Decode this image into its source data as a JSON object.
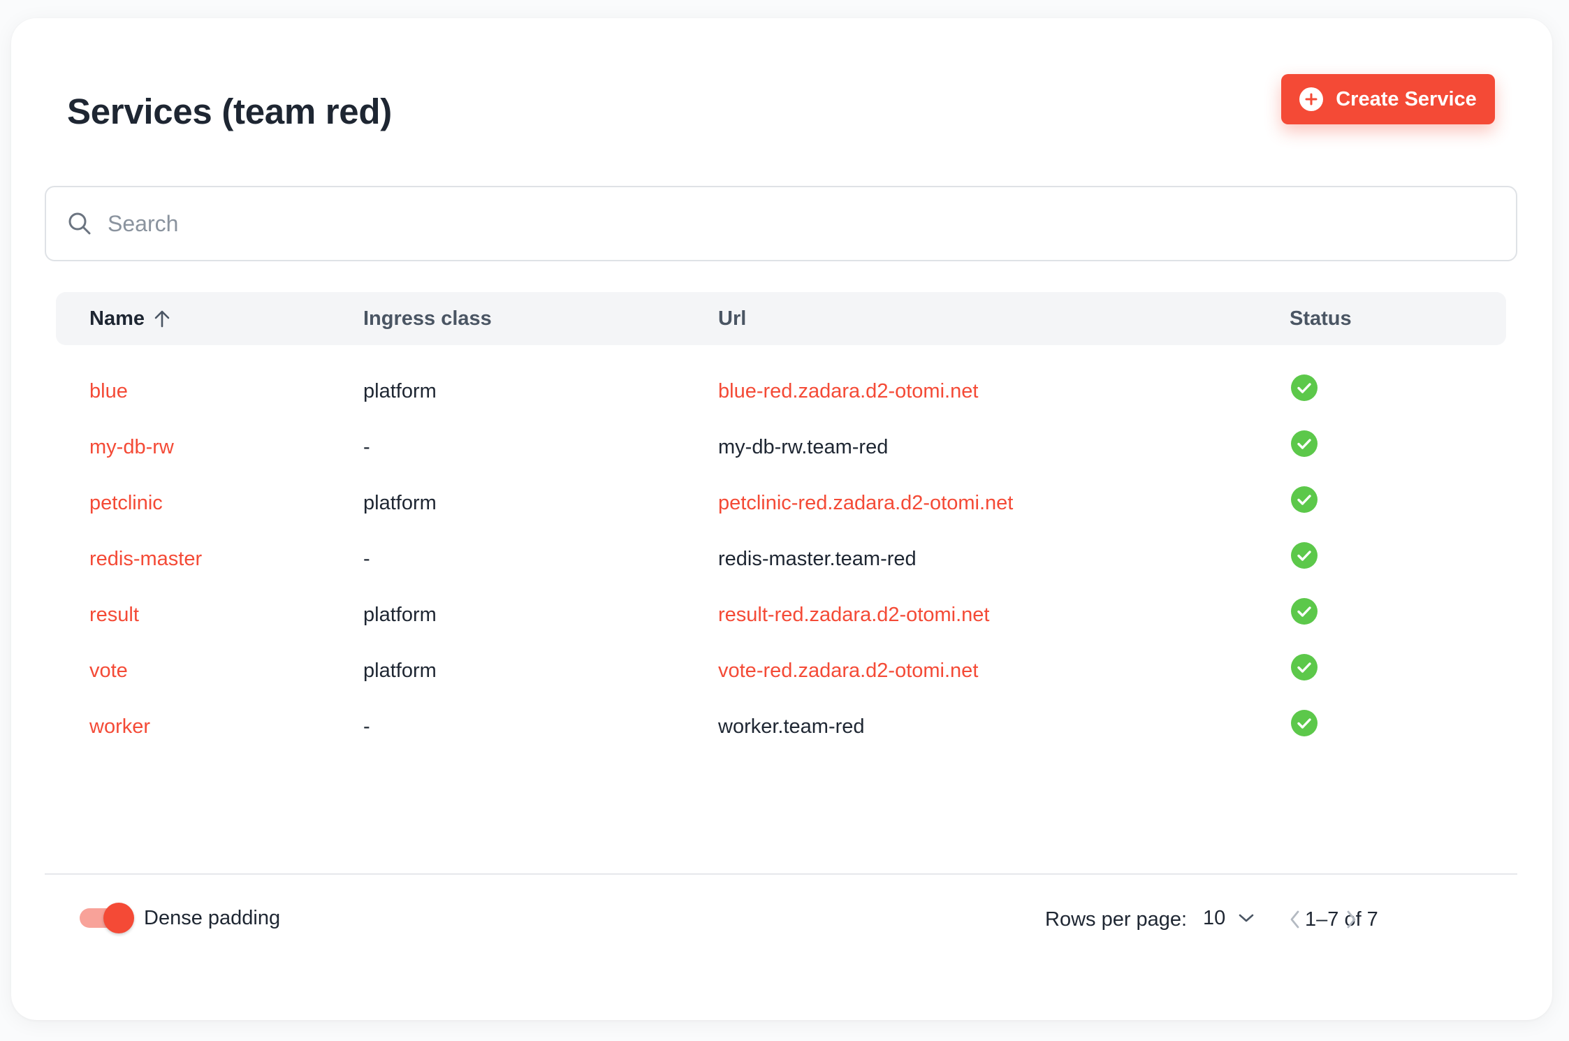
{
  "header": {
    "title": "Services (team red)",
    "create_label": "Create Service"
  },
  "search": {
    "placeholder": "Search",
    "value": ""
  },
  "table": {
    "columns": {
      "name": "Name",
      "ingress": "Ingress class",
      "url": "Url",
      "status": "Status"
    },
    "sort": {
      "column": "Name",
      "direction": "ascending"
    },
    "rows": [
      {
        "name": "blue",
        "ingress": "platform",
        "url": "blue-red.zadara.d2-otomi.net",
        "url_is_link": true,
        "status": "check-circle-icon"
      },
      {
        "name": "my-db-rw",
        "ingress": "-",
        "url": "my-db-rw.team-red",
        "url_is_link": false,
        "status": "check-circle-icon"
      },
      {
        "name": "petclinic",
        "ingress": "platform",
        "url": "petclinic-red.zadara.d2-otomi.net",
        "url_is_link": true,
        "status": "check-circle-icon"
      },
      {
        "name": "redis-master",
        "ingress": "-",
        "url": "redis-master.team-red",
        "url_is_link": false,
        "status": "check-circle-icon"
      },
      {
        "name": "result",
        "ingress": "platform",
        "url": "result-red.zadara.d2-otomi.net",
        "url_is_link": true,
        "status": "check-circle-icon"
      },
      {
        "name": "vote",
        "ingress": "platform",
        "url": "vote-red.zadara.d2-otomi.net",
        "url_is_link": true,
        "status": "check-circle-icon"
      },
      {
        "name": "worker",
        "ingress": "-",
        "url": "worker.team-red",
        "url_is_link": false,
        "status": "check-circle-icon"
      }
    ]
  },
  "footer": {
    "dense_label": "Dense padding",
    "dense_enabled": true,
    "rows_per_page_label": "Rows per page:",
    "rows_per_page_value": "10",
    "range": "1–7 of 7"
  },
  "colors": {
    "accent": "#f44a36",
    "success": "#5cc84a",
    "text": "#1e2632"
  }
}
